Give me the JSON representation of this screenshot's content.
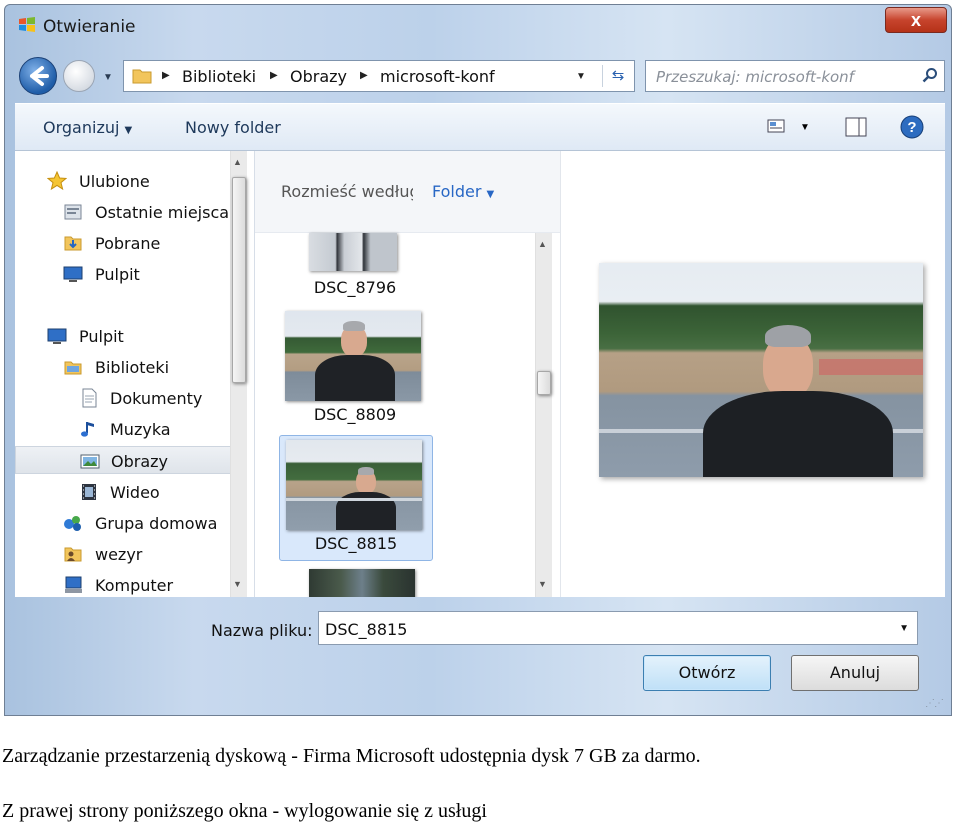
{
  "window": {
    "title": "Otwieranie",
    "close_label": "x"
  },
  "address": {
    "crumbs": [
      "Biblioteki",
      "Obrazy",
      "microsoft-konf"
    ]
  },
  "search": {
    "placeholder": "Przeszukaj: microsoft-konf"
  },
  "toolbar": {
    "organize_label": "Organizuj",
    "new_folder_label": "Nowy folder"
  },
  "sidebar": {
    "items": [
      {
        "label": "Ulubione",
        "icon": "star-icon"
      },
      {
        "label": "Ostatnie miejsca",
        "icon": "recent-places-icon"
      },
      {
        "label": "Pobrane",
        "icon": "downloads-folder-icon"
      },
      {
        "label": "Pulpit",
        "icon": "desktop-icon"
      },
      {
        "label": "Pulpit",
        "icon": "desktop-icon"
      },
      {
        "label": "Biblioteki",
        "icon": "libraries-icon"
      },
      {
        "label": "Dokumenty",
        "icon": "documents-icon"
      },
      {
        "label": "Muzyka",
        "icon": "music-icon"
      },
      {
        "label": "Obrazy",
        "icon": "pictures-icon",
        "selected": true
      },
      {
        "label": "Wideo",
        "icon": "video-icon"
      },
      {
        "label": "Grupa domowa",
        "icon": "homegroup-icon"
      },
      {
        "label": "wezyr",
        "icon": "user-folder-icon"
      },
      {
        "label": "Komputer",
        "icon": "computer-icon"
      }
    ]
  },
  "arrange": {
    "label": "Rozmieść według:",
    "value": "Folder"
  },
  "files": [
    {
      "name": "DSC_8796",
      "selected": false
    },
    {
      "name": "DSC_8809",
      "selected": false
    },
    {
      "name": "DSC_8815",
      "selected": true
    }
  ],
  "bottom": {
    "filename_label": "Nazwa pliku:",
    "filename_value": "DSC_8815",
    "open_label": "Otwórz",
    "cancel_label": "Anuluj"
  },
  "captions": {
    "line1": "Zarządzanie przestarzenią dyskową - Firma Microsoft udostępnia dysk 7 GB za darmo.",
    "line2": "Z prawej strony poniższego okna - wylogowanie się z usługi"
  },
  "colors": {
    "accent": "#2867c5",
    "selection": "#d9e8fb",
    "close": "#c7442d"
  }
}
